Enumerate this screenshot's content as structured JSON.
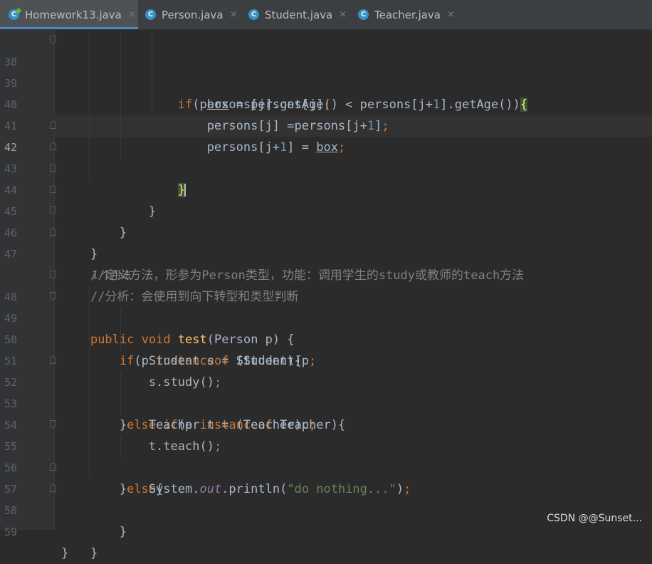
{
  "tabs": [
    {
      "label": "Homework13.java",
      "icon": "java-class-main-icon"
    },
    {
      "label": "Person.java",
      "icon": "java-class-icon"
    },
    {
      "label": "Student.java",
      "icon": "java-class-icon"
    },
    {
      "label": "Teacher.java",
      "icon": "java-class-icon"
    }
  ],
  "tab_icon_letter": "C",
  "close_glyph": "×",
  "lines": [
    {
      "n": "38",
      "code": "                if(persons[j].getAge() < persons[j+1].getAge()){"
    },
    {
      "n": "39",
      "code": "                    box = persons[j];"
    },
    {
      "n": "40",
      "code": "                    persons[j] =persons[j+1];"
    },
    {
      "n": "41",
      "code": "                    persons[j+1] = box;"
    },
    {
      "n": "42",
      "code": "                }"
    },
    {
      "n": "43",
      "code": "            }"
    },
    {
      "n": "44",
      "code": "        }"
    },
    {
      "n": "45",
      "code": "    }"
    },
    {
      "n": "46",
      "code": "    //定义方法，形参为Person类型，功能：调用学生的study或教师的teach方法"
    },
    {
      "n": "47",
      "code": "    //分析：会使用到向下转型和类型判断"
    },
    {
      "n": "",
      "code": "1 个用法"
    },
    {
      "n": "48",
      "code": "    public void test(Person p) {"
    },
    {
      "n": "49",
      "code": "        if(p instanceof Student){"
    },
    {
      "n": "50",
      "code": "            Student s = (Student)p;"
    },
    {
      "n": "51",
      "code": "            s.study();"
    },
    {
      "n": "52",
      "code": "        }else if(p instanceof Teacher){"
    },
    {
      "n": "53",
      "code": "            Teacher t = (Teacher)p;"
    },
    {
      "n": "54",
      "code": "            t.teach();"
    },
    {
      "n": "55",
      "code": "        }else{"
    },
    {
      "n": "56",
      "code": "            System.out.println(\"do nothing...\");"
    },
    {
      "n": "57",
      "code": "        }"
    },
    {
      "n": "58",
      "code": "    }"
    },
    {
      "n": "59",
      "code": "}"
    }
  ],
  "colors": {
    "background": "#2b2b2b",
    "keyword": "#cc7832",
    "method": "#ffc66d",
    "number": "#6897bb",
    "string": "#6a8759",
    "comment": "#808080",
    "field": "#9876aa",
    "tab_accent": "#4a88c7"
  },
  "watermark": "CSDN @@Sunset..."
}
